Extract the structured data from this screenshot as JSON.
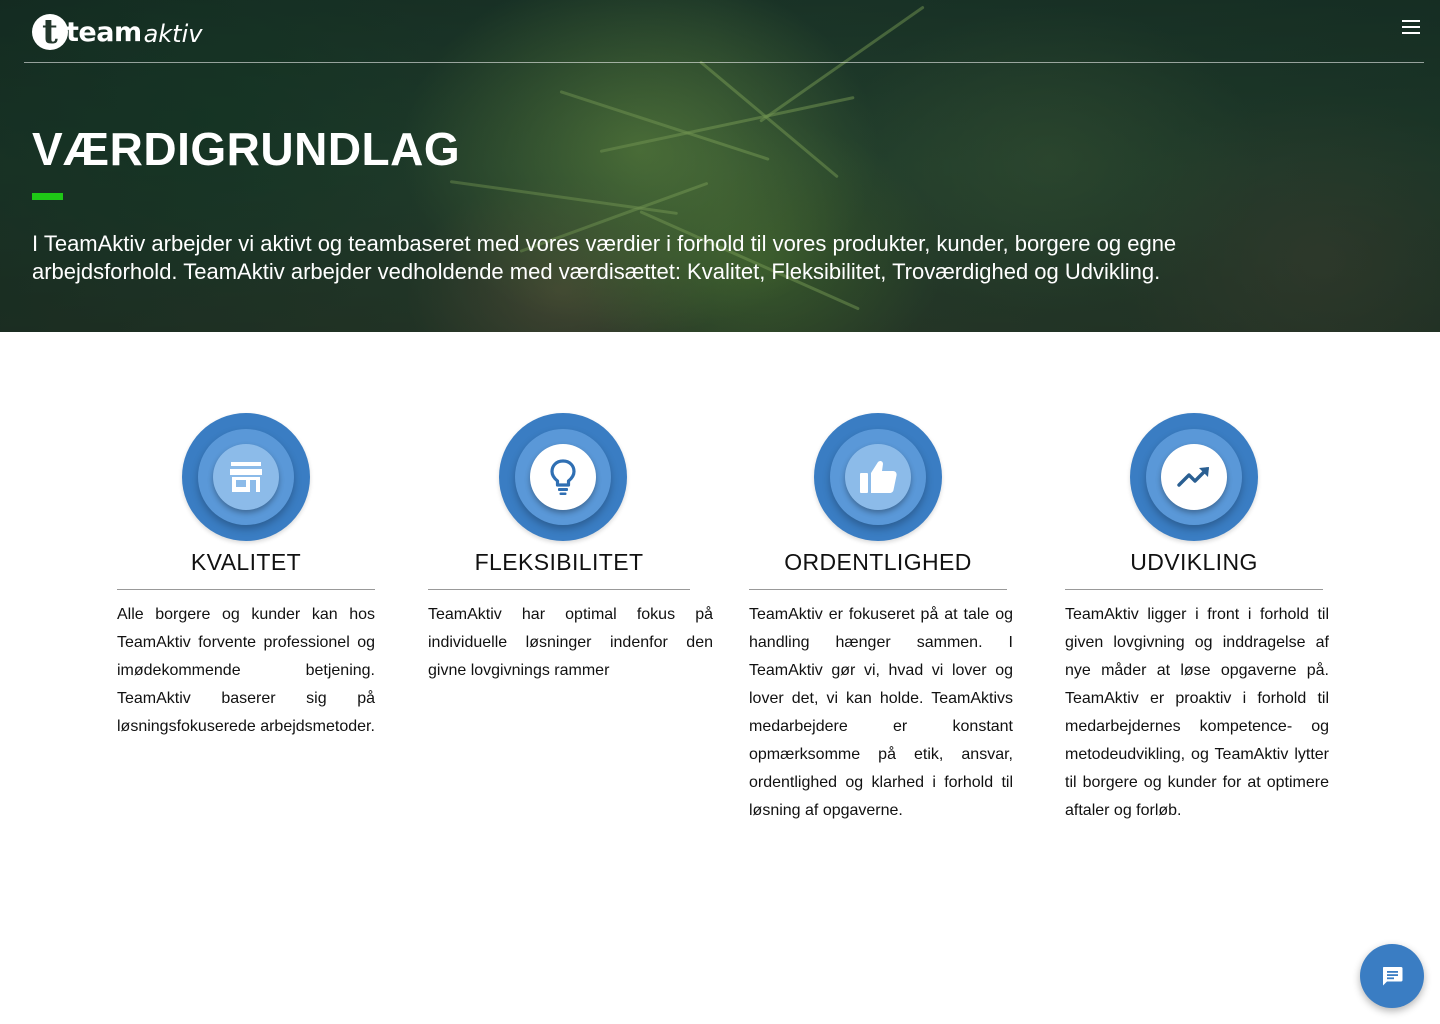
{
  "header": {
    "logo_bold": "team",
    "logo_italic": "aktiv",
    "logo_mark": "t",
    "menu_icon": "hamburger-menu-icon"
  },
  "hero": {
    "title": "VÆRDIGRUNDLAG",
    "accent_color": "#1ec816",
    "text": "I TeamAktiv arbejder vi aktivt og teambaseret med vores værdier i forhold til vores produkter, kunder, borgere og egne arbejdsforhold. TeamAktiv arbejder vedholdende med værdisættet: Kvalitet, Fleksibilitet, Troværdighed og Udvikling."
  },
  "values": [
    {
      "title": "KVALITET",
      "icon": "storefront-icon",
      "text": "Alle borgere og kunder kan hos TeamAktiv forvente professionel og imødekommende betjening. TeamAktiv baserer sig på løsningsfokuserede arbejdsmetoder."
    },
    {
      "title": "FLEKSIBILITET",
      "icon": "lightbulb-icon",
      "text": "TeamAktiv har optimal fokus på individuelle løsninger indenfor den givne lovgivnings rammer"
    },
    {
      "title": "ORDENTLIGHED",
      "icon": "thumbs-up-icon",
      "text": "TeamAktiv er fokuseret på at tale og handling hænger sammen. I TeamAktiv gør vi, hvad vi lover og lover det, vi kan holde. TeamAktivs medarbejdere er konstant opmærksomme på etik, ansvar, ordentlighed og klarhed i forhold til løsning af opgaverne."
    },
    {
      "title": "UDVIKLING",
      "icon": "trending-up-icon",
      "text": "TeamAktiv ligger i front i forhold til given lovgivning og inddragelse af nye måder at løse opgaverne på. TeamAktiv er proaktiv i forhold til medarbejdernes kompetence- og metodeudvikling, og TeamAktiv lytter til borgere og kunder for at optimere aftaler og forløb."
    }
  ],
  "chat": {
    "icon": "chat-icon",
    "color": "#3a7dc3"
  },
  "colors": {
    "icon_outer": "#3a7dc3",
    "icon_ring": "#5a98d8",
    "icon_core": "#8cbbe9"
  }
}
